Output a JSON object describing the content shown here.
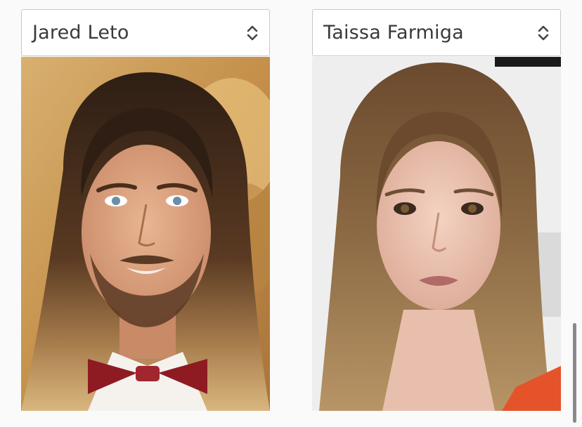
{
  "selectors": [
    {
      "selected": "Jared Leto"
    },
    {
      "selected": "Taissa Farmiga"
    }
  ],
  "icons": {
    "select": "chevron-up-down-icon"
  },
  "colors": {
    "page_background": "#fafafa",
    "select_border": "#c8c8c8",
    "select_text": "#3a3a3a",
    "scrollbar": "#8a8a8a"
  }
}
